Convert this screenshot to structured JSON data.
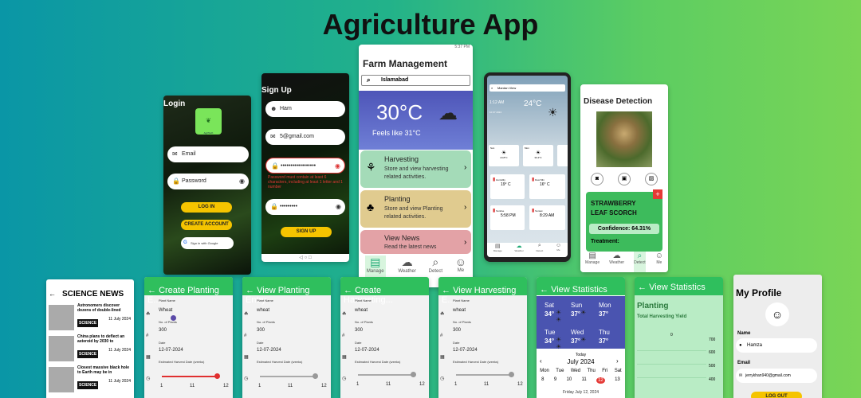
{
  "page_title": "Agriculture App",
  "login": {
    "title": "Login",
    "logo_text": "AgriTech",
    "email_ph": "Email",
    "password_ph": "Password",
    "login_btn": "LOG IN",
    "create_btn": "CREATE ACCOUNT",
    "google_btn": "Sign in with Google"
  },
  "signup": {
    "title": "Sign Up",
    "name": "Ham",
    "email": "5@gmail.com",
    "password": "••••••••••••••••••",
    "error": "Password must contain at least 6 characters, including at least 1 letter and 1 number",
    "confirm": "•••••••••",
    "btn": "SIGN UP"
  },
  "farm": {
    "status": "5:37 PM",
    "title": "Farm Management",
    "search": "Islamabad",
    "temp": "30°C",
    "feels": "Feels like 31°C",
    "cards": [
      {
        "title": "Harvesting",
        "desc": "Store and view harvesting related activities."
      },
      {
        "title": "Planting",
        "desc": "Store and view Planting related activities."
      },
      {
        "title": "View News",
        "desc": "Read the latest news"
      }
    ],
    "nav": [
      "Manage",
      "Weather",
      "Detect",
      "Me"
    ]
  },
  "weather": {
    "location": "Mardan View",
    "time": "1:12 AM",
    "temp": "24°C",
    "date": "10 07 2024",
    "days": [
      "Sun",
      "Mon",
      ""
    ],
    "day_temps": [
      "24.8°C",
      "30.4°C",
      ""
    ],
    "tiles": [
      {
        "label": "Humidity",
        "val": "19° C"
      },
      {
        "label": "Dew Min",
        "val": "16° C"
      },
      {
        "label": "Sunrise",
        "val": "5:58 PM"
      },
      {
        "label": "Sunset",
        "val": "8:29 AM"
      }
    ],
    "nav": [
      "Manage",
      "Weather",
      "Detect",
      "Me"
    ]
  },
  "disease": {
    "title": "Disease Detection",
    "result": "STRAWBERRY LEAF SCORCH",
    "confidence": "Confidence: 64.31%",
    "treatment": "Treatment:",
    "nav": [
      "Manage",
      "Weather",
      "Detect",
      "Me"
    ]
  },
  "news": {
    "title": "SCIENCE NEWS",
    "items": [
      {
        "headline": "Astronomers discover dozens of double-lined",
        "tag": "SCIENCE",
        "date": "11 July 2024"
      },
      {
        "headline": "China plans to deflect an asteroid by 2030 to",
        "tag": "SCIENCE",
        "date": "11 July 2024"
      },
      {
        "headline": "Closest massive black hole to Earth may be in",
        "tag": "SCIENCE",
        "date": "11 July 2024"
      }
    ]
  },
  "forms": [
    {
      "title": "Create Planting E...",
      "fields": [
        [
          "Plant Name",
          "Wheat"
        ],
        [
          "No. of Plants",
          "300"
        ],
        [
          "Date",
          "12-07-2024"
        ]
      ],
      "slider_label": "Estimated Harvest Date (weeks)",
      "ticks": [
        "1",
        "11",
        "12"
      ],
      "dot": "#e03030"
    },
    {
      "title": "View Planting Entry",
      "fields": [
        [
          "Plant Name",
          "wheat"
        ],
        [
          "No. of Plants",
          "300"
        ],
        [
          "Date",
          "12-07-2024"
        ]
      ],
      "slider_label": "Estimated Harvest Date (weeks)",
      "ticks": [
        "1",
        "11",
        "12"
      ],
      "dot": "#999"
    },
    {
      "title": "Create Harvesting...",
      "fields": [
        [
          "Plant Name",
          "wheat"
        ],
        [
          "No. of Plants",
          "300"
        ],
        [
          "Date",
          "12-07-2024"
        ]
      ],
      "slider_label": "Estimated Harvest Date (weeks)",
      "ticks": [
        "1",
        "11",
        "12"
      ],
      "dot": "#999"
    },
    {
      "title": "View Harvesting E...",
      "fields": [
        [
          "Plant Name",
          "wheat"
        ],
        [
          "No. of Plants",
          "300"
        ],
        [
          "Date",
          "12-07-2024"
        ]
      ],
      "slider_label": "Estimated Harvest Date (weeks)",
      "ticks": [
        "1",
        "11",
        "12"
      ],
      "dot": "#999"
    }
  ],
  "stats1": {
    "title": "View Statistics",
    "days": [
      [
        "Sat",
        "34°"
      ],
      [
        "Sun",
        "37°"
      ],
      [
        "Mon",
        "37°"
      ],
      [
        "Tue",
        "34°"
      ],
      [
        "Wed",
        "37°"
      ],
      [
        "Thu",
        "37°"
      ]
    ],
    "today": "Today",
    "month": "July 2024",
    "dow": [
      "Mon",
      "Tue",
      "Wed",
      "Thu",
      "Fri",
      "Sat"
    ],
    "dates": [
      "8",
      "9",
      "10",
      "11",
      "12",
      "13"
    ],
    "footer": "Friday July 12, 2024"
  },
  "stats2": {
    "title": "View Statistics",
    "section": "Planting",
    "sub": "Total Harvesting Yield",
    "y0": "0",
    "yticks": [
      "700",
      "600",
      "500",
      "400"
    ]
  },
  "profile": {
    "title": "My Profile",
    "name_label": "Name",
    "name": "Hamza",
    "email_label": "Email",
    "email": "jerrykhan940@gmail.com",
    "btn": "LOG OUT"
  },
  "colors": {
    "green": "#2fbf5d",
    "yellow": "#f5c400",
    "blue": "#4a54b0"
  }
}
